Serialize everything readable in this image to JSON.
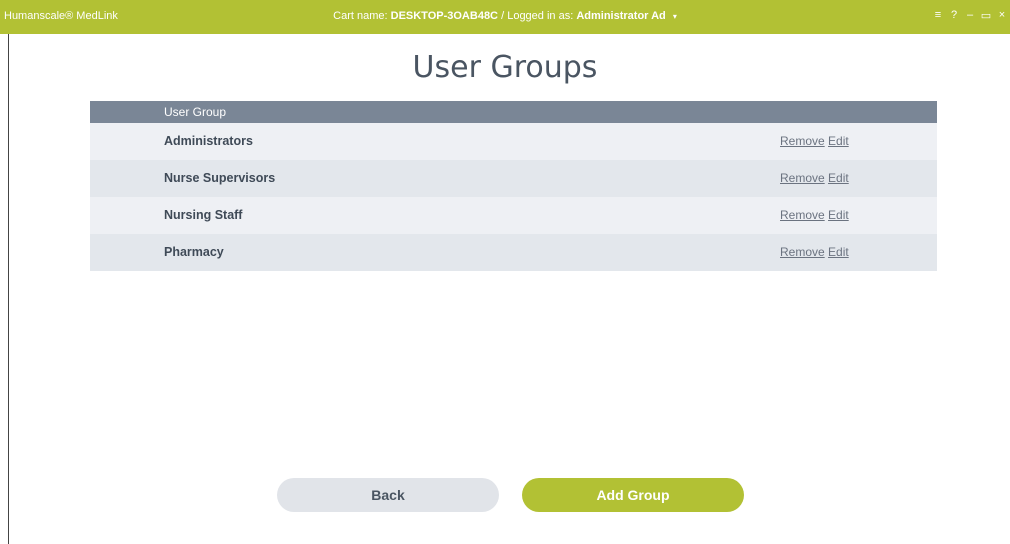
{
  "titlebar": {
    "brand": "Humanscale® MedLink",
    "cart_label": "Cart name:",
    "cart_name": "DESKTOP-3OAB48C",
    "separator": "/",
    "logged_label": "Logged in as:",
    "user": "Administrator Ad",
    "controls": [
      "≡",
      "?",
      "–",
      "▭",
      "×"
    ]
  },
  "page": {
    "title": "User Groups"
  },
  "table": {
    "column_header": "User Group",
    "rows": [
      {
        "name": "Administrators",
        "remove": "Remove",
        "edit": "Edit"
      },
      {
        "name": "Nurse Supervisors",
        "remove": "Remove",
        "edit": "Edit"
      },
      {
        "name": "Nursing Staff",
        "remove": "Remove",
        "edit": "Edit"
      },
      {
        "name": "Pharmacy",
        "remove": "Remove",
        "edit": "Edit"
      }
    ]
  },
  "buttons": {
    "back": "Back",
    "add_group": "Add Group"
  },
  "colors": {
    "accent": "#b2c134",
    "header": "#7a8696"
  }
}
